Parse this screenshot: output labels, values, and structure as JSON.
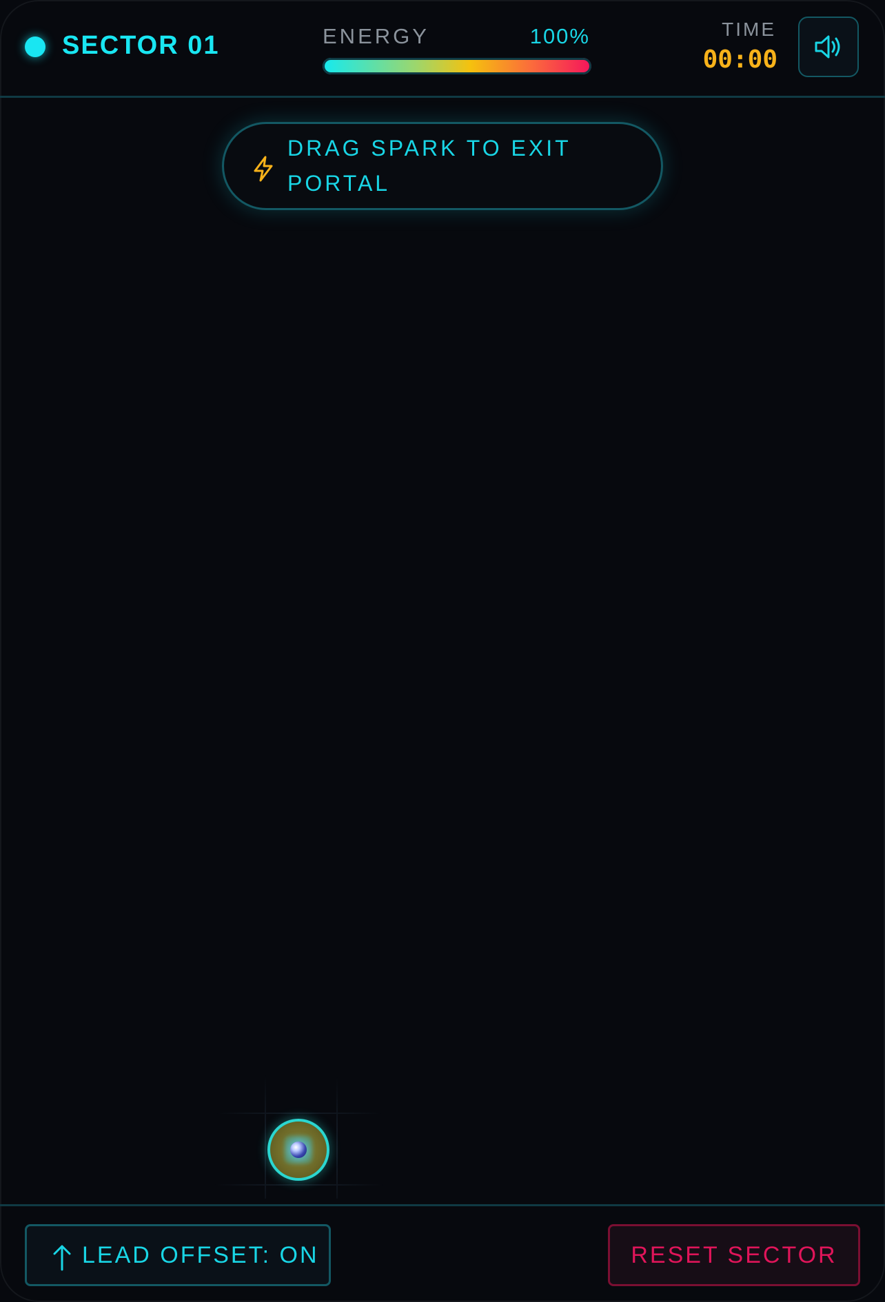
{
  "header": {
    "sector_title": "SECTOR 01",
    "energy_label": "ENERGY",
    "energy_value": "100%",
    "energy_level_percent": 100,
    "time_label": "TIME",
    "time_value": "00:00",
    "sound_icon": "speaker-volume-icon"
  },
  "instruction": {
    "icon": "lightning-bolt-icon",
    "text": "DRAG SPARK TO EXIT PORTAL"
  },
  "playfield": {
    "spark_icon": "spark-orb-icon"
  },
  "footer": {
    "lead_offset_icon": "arrow-up-icon",
    "lead_offset_label": "LEAD OFFSET: ON",
    "reset_label": "RESET SECTOR"
  },
  "colors": {
    "background": "#07090e",
    "accent_cyan": "#19e6f2",
    "timer_amber": "#f7b21a",
    "reset_red": "#e0155a",
    "border_teal": "#135863",
    "energy_gradient": [
      "#14eaf0",
      "#9ed66b",
      "#f5c10e",
      "#fb6a3c",
      "#f5145c"
    ]
  }
}
